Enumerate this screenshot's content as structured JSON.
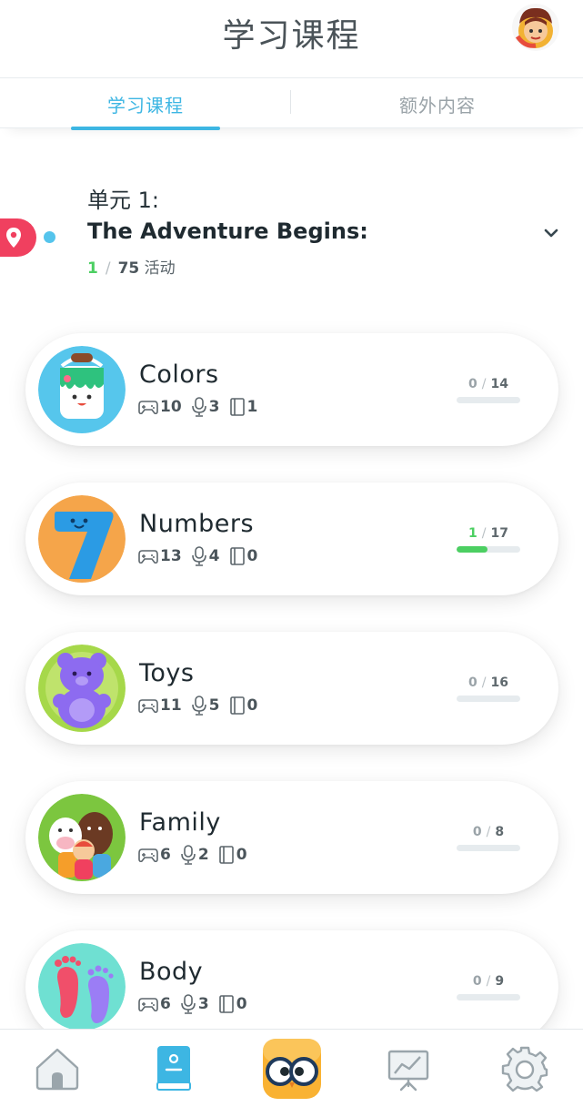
{
  "header": {
    "title": "学习课程"
  },
  "tabs": [
    {
      "label": "学习课程",
      "active": true
    },
    {
      "label": "额外内容",
      "active": false
    }
  ],
  "unit": {
    "number_label": "单元 1:",
    "title": "The Adventure Begins:",
    "progress_done": "1",
    "progress_sep": "/",
    "progress_total": "75",
    "progress_suffix": "活动"
  },
  "lessons": [
    {
      "name": "Colors",
      "games": "10",
      "speaking": "3",
      "books": "1",
      "done": "0",
      "sep": "/",
      "total": "14",
      "progress_fraction": 0
    },
    {
      "name": "Numbers",
      "games": "13",
      "speaking": "4",
      "books": "0",
      "done": "1",
      "sep": "/",
      "total": "17",
      "progress_fraction": 0.48
    },
    {
      "name": "Toys",
      "games": "11",
      "speaking": "5",
      "books": "0",
      "done": "0",
      "sep": "/",
      "total": "16",
      "progress_fraction": 0
    },
    {
      "name": "Family",
      "games": "6",
      "speaking": "2",
      "books": "0",
      "done": "0",
      "sep": "/",
      "total": "8",
      "progress_fraction": 0
    },
    {
      "name": "Body",
      "games": "6",
      "speaking": "3",
      "books": "0",
      "done": "0",
      "sep": "/",
      "total": "9",
      "progress_fraction": 0
    }
  ],
  "icons": {
    "stat_games": "gamepad-icon",
    "stat_speaking": "microphone-icon",
    "stat_books": "book-icon",
    "nav": [
      "home-icon",
      "book-course-icon",
      "owl-mascot-icon",
      "stats-board-icon",
      "gear-icon"
    ]
  },
  "colors": {
    "accent": "#3db6e3",
    "progress": "#4ccf62",
    "pin": "#f0405f",
    "bar_track": "#e6ebee"
  }
}
